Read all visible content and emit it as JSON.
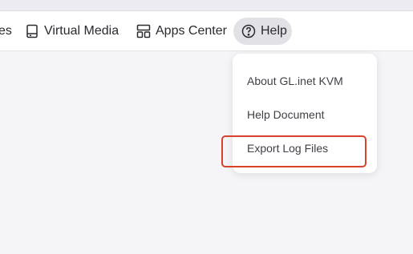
{
  "toolbar": {
    "partial_label": "es",
    "virtual_media": {
      "label": "Virtual Media",
      "icon": "drive-icon"
    },
    "apps_center": {
      "label": "Apps Center",
      "icon": "grid-icon"
    },
    "help": {
      "label": "Help",
      "icon": "question-circle-icon",
      "active": true
    }
  },
  "help_menu": {
    "items": [
      {
        "label": "About GL.inet KVM"
      },
      {
        "label": "Help Document"
      },
      {
        "label": "Export Log Files"
      }
    ]
  },
  "colors": {
    "highlight_border": "#d9412f",
    "active_tab_bg": "#e2e2e6"
  }
}
